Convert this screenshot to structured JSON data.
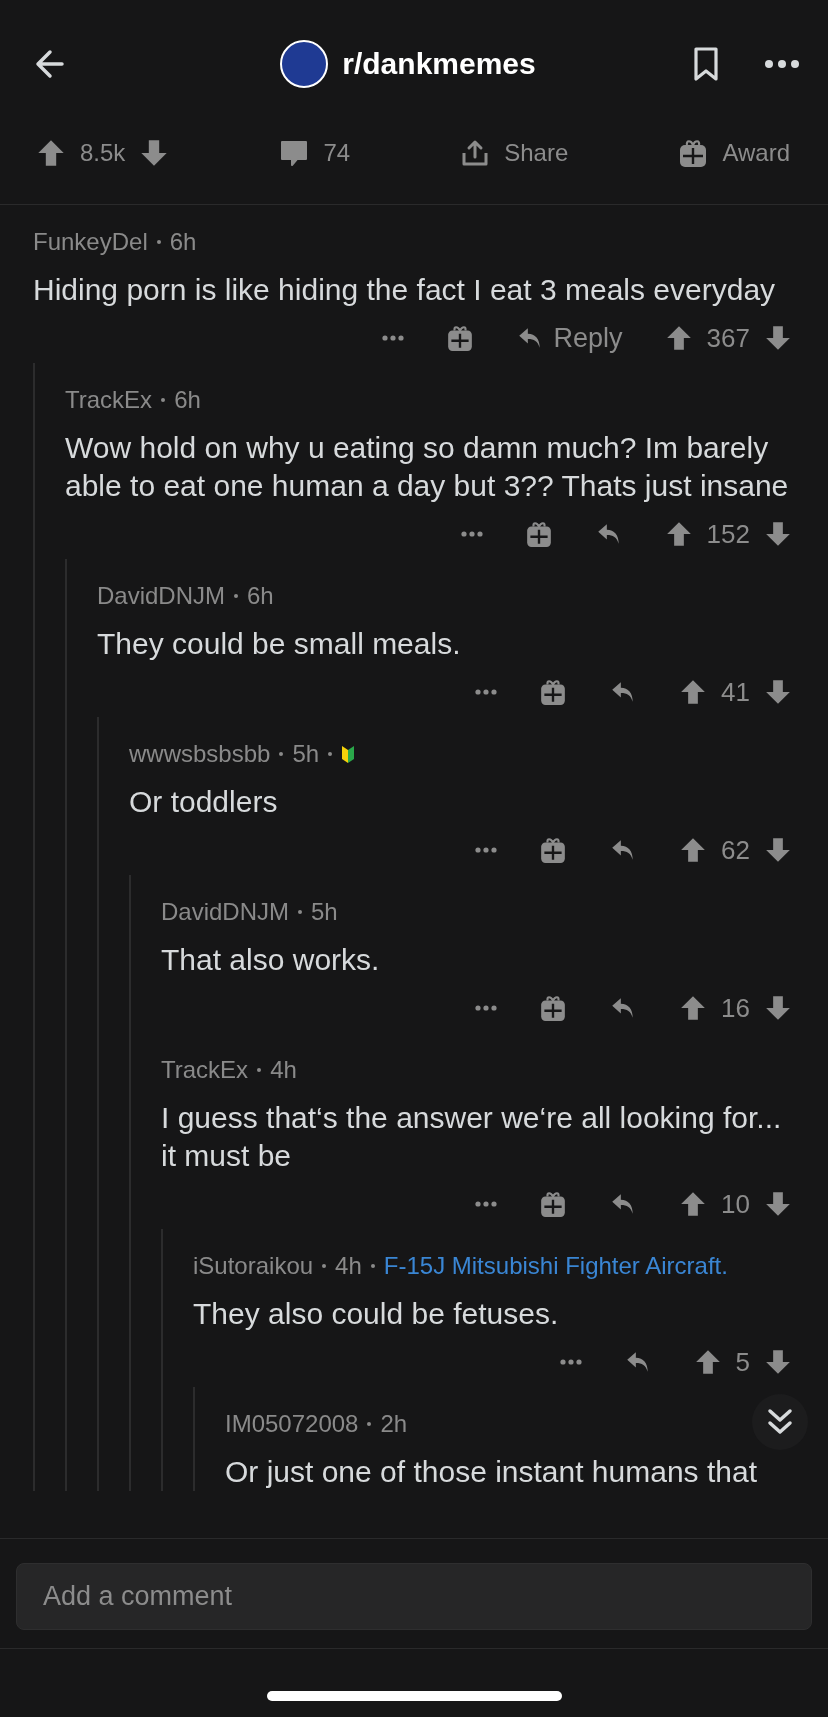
{
  "header": {
    "subreddit": "r/dankmemes"
  },
  "post_actions": {
    "score": "8.5k",
    "comments": "74",
    "share": "Share",
    "award": "Award"
  },
  "comments": [
    {
      "author": "FunkeyDel",
      "age": "6h",
      "badge": false,
      "body": "Hiding porn is like hiding the fact I eat 3 meals everyday",
      "award": true,
      "reply_label": "Reply",
      "score": "367",
      "children": [
        {
          "author": "TrackEx",
          "age": "6h",
          "badge": false,
          "body": "Wow hold on why u eating so damn much? Im barely able to eat one human a day but 3?? Thats just insane",
          "award": true,
          "score": "152",
          "children": [
            {
              "author": "DavidDNJM",
              "age": "6h",
              "badge": false,
              "body": "They could be small meals.",
              "award": true,
              "score": "41",
              "children": [
                {
                  "author": "wwwsbsbsbb",
                  "age": "5h",
                  "badge": true,
                  "body": "Or toddlers",
                  "award": true,
                  "score": "62",
                  "children": [
                    {
                      "author": "DavidDNJM",
                      "age": "5h",
                      "badge": false,
                      "body": "That also works.",
                      "award": true,
                      "score": "16"
                    },
                    {
                      "author": "TrackEx",
                      "age": "4h",
                      "badge": false,
                      "body": "I guess that‘s the answer we‘re all looking for... it must be",
                      "award": true,
                      "score": "10",
                      "children": [
                        {
                          "author": "iSutoraikou",
                          "age": "4h",
                          "badge": false,
                          "flair": "F-15J Mitsubishi Fighter Aircraft.",
                          "body": "They also could be fetuses.",
                          "award": false,
                          "score": "5",
                          "children": [
                            {
                              "author": "IM05072008",
                              "age": "2h",
                              "badge": false,
                              "body": "Or just one of those instant humans that"
                            }
                          ]
                        }
                      ]
                    }
                  ]
                }
              ]
            }
          ]
        }
      ]
    }
  ],
  "composer": {
    "placeholder": "Add a comment"
  }
}
